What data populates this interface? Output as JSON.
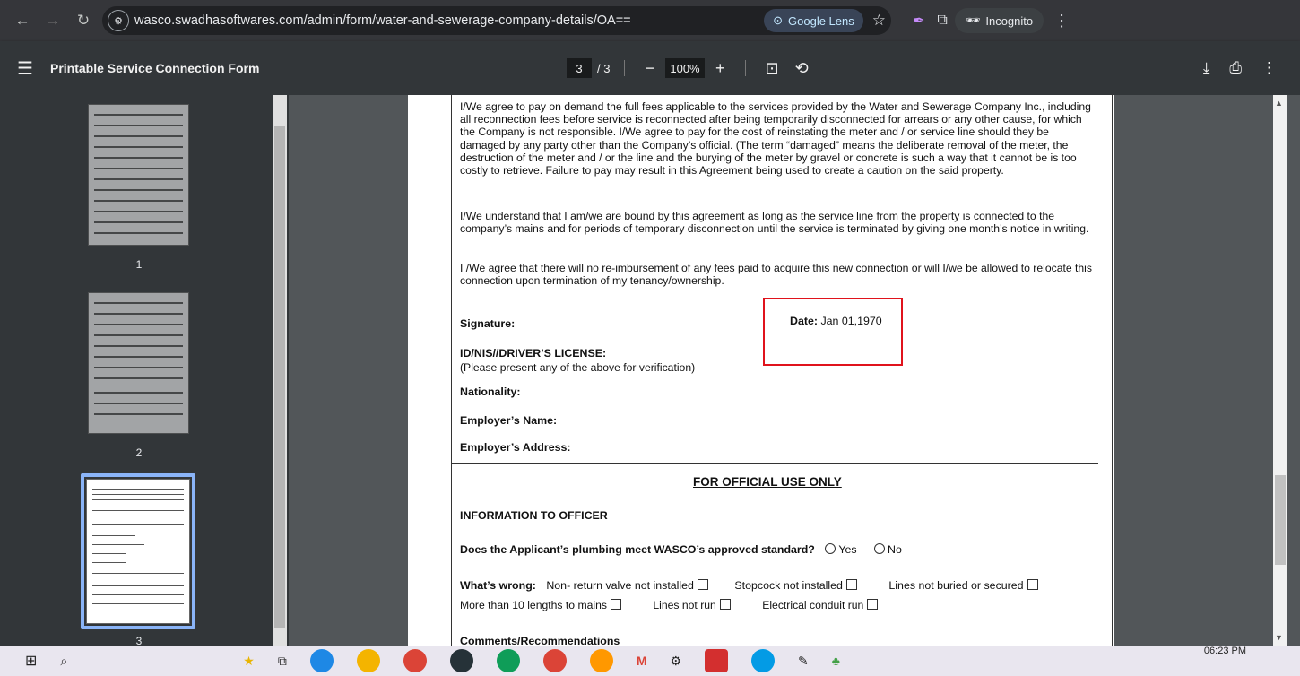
{
  "browser": {
    "url": "wasco.swadhasoftwares.com/admin/form/water-and-sewerage-company-details/OA==",
    "lens_label": "Google Lens",
    "incognito_label": "Incognito"
  },
  "pdf_toolbar": {
    "title": "Printable Service Connection Form",
    "current_page": "3",
    "total_pages": "/ 3",
    "zoom": "100%"
  },
  "sidebar": {
    "thumbnails": [
      {
        "label": "1"
      },
      {
        "label": "2"
      },
      {
        "label": "3"
      }
    ]
  },
  "document": {
    "para1": "I/We agree to pay on demand the full fees applicable to the services provided by the Water and Sewerage Company Inc., including all reconnection fees before service is reconnected after being temporarily disconnected for arrears or any other cause, for which the Company is not responsible. I/We agree to pay for the cost of reinstating the meter and / or service line should they be damaged by any party other than the Company’s official. (The term “damaged” means the deliberate removal of the meter, the destruction of the meter and / or the line and the burying of the meter by gravel or concrete is such a way that it cannot be is too costly to retrieve. Failure to pay may result in this Agreement being used to create a caution on the said property.",
    "para2": "I/We understand that I am/we are bound by this agreement as long as the service line from the property is connected to the company’s mains and for periods of temporary disconnection until the service is terminated by giving one month’s notice in writing.",
    "para3": "I /We agree that there will no re-imbursement of any fees paid to acquire this new connection or will I/we be allowed to relocate this connection upon termination of my tenancy/ownership.",
    "signature_label": "Signature:",
    "date_label": "Date:",
    "date_value": "Jan 01,1970",
    "id_label": "ID/NIS//DRIVER’S LICENSE:",
    "id_note": "(Please present any of the above for verification)",
    "nationality_label": "Nationality:",
    "employer_name_label": "Employer’s Name:",
    "employer_address_label": "Employer’s Address:",
    "official_heading": "FOR OFFICIAL USE ONLY",
    "info_heading": "INFORMATION TO OFFICER",
    "plumbing_question": "Does the Applicant’s plumbing meet WASCO’s approved standard?",
    "yes_label": "Yes",
    "no_label": "No",
    "whats_wrong_label": "What’s wrong:",
    "opt1": "Non- return valve not installed",
    "opt2": "Stopcock not installed",
    "opt3": "Lines not buried or secured",
    "opt4": "More than 10 lengths to mains",
    "opt5": "Lines not run",
    "opt6": "Electrical conduit run",
    "comments_label": "Comments/Recommendations"
  },
  "taskbar": {
    "time": "06:23 PM"
  }
}
